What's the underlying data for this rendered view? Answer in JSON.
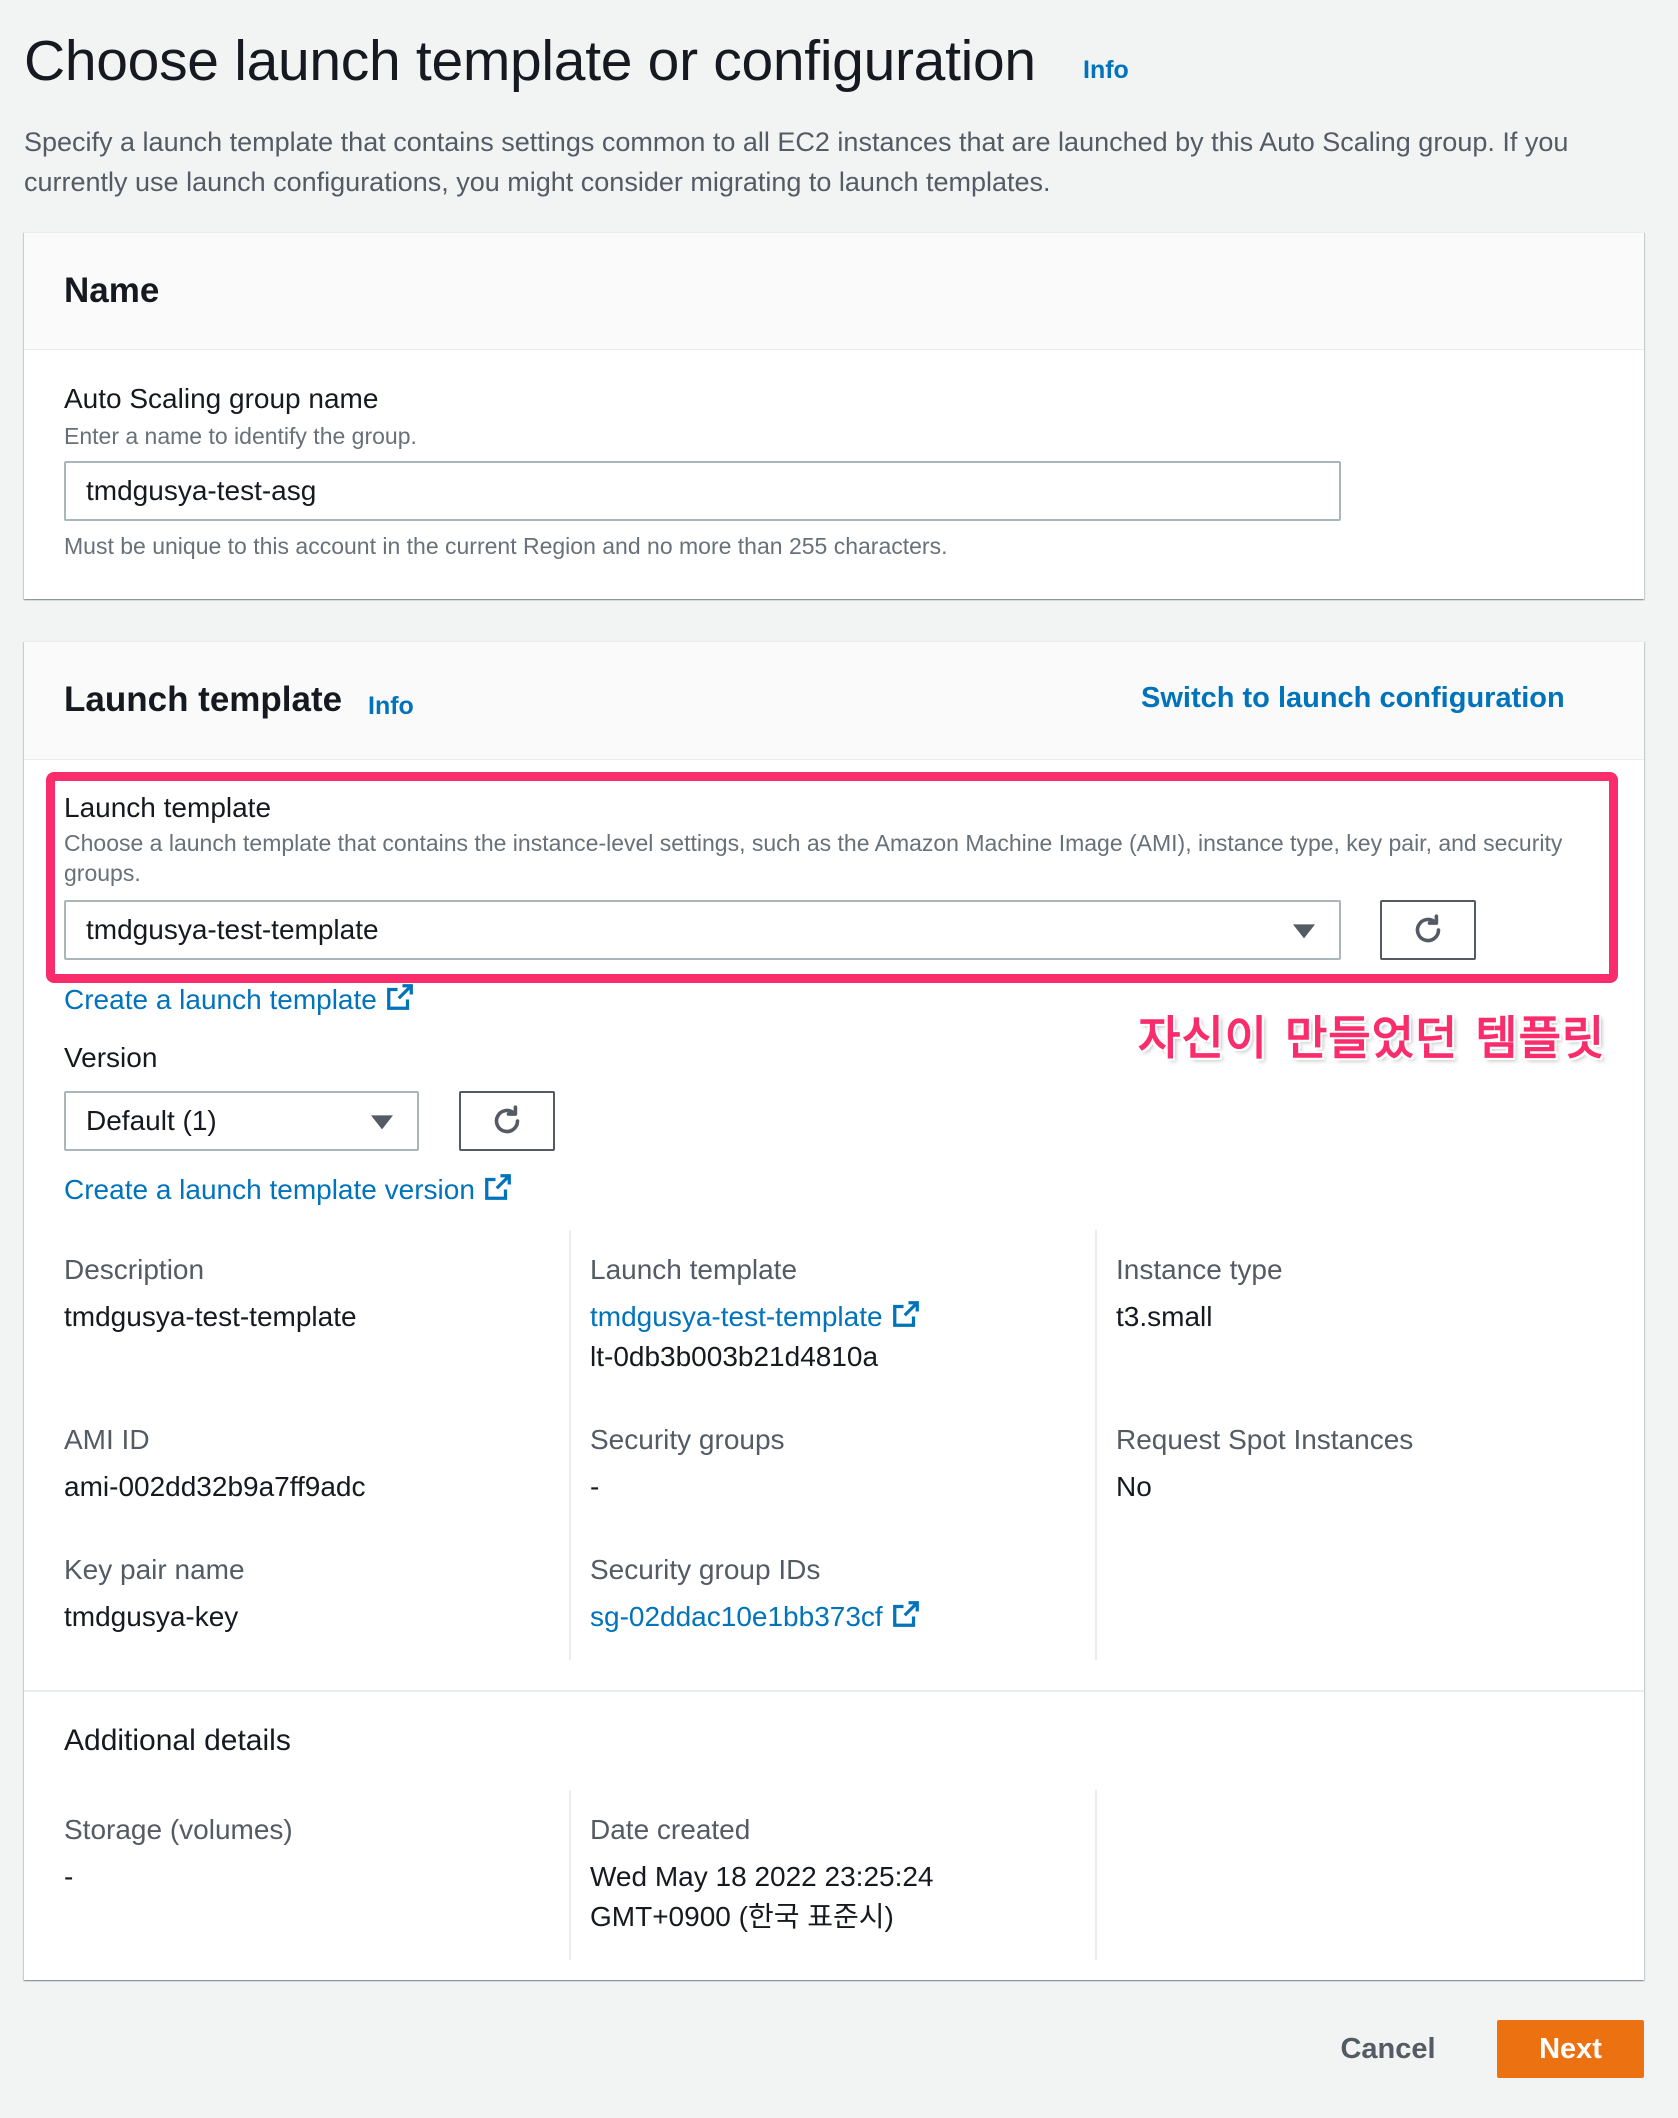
{
  "page": {
    "title": "Choose launch template or configuration",
    "info": "Info",
    "description": "Specify a launch template that contains settings common to all EC2 instances that are launched by this Auto Scaling group. If you currently use launch configurations, you might consider migrating to launch templates."
  },
  "name_panel": {
    "title": "Name",
    "field_label": "Auto Scaling group name",
    "field_hint": "Enter a name to identify the group.",
    "field_value": "tmdgusya-test-asg",
    "field_constraint": "Must be unique to this account in the current Region and no more than 255 characters."
  },
  "template_panel": {
    "title": "Launch template",
    "info": "Info",
    "switch_link": "Switch to launch configuration",
    "template_label": "Launch template",
    "template_hint": "Choose a launch template that contains the instance-level settings, such as the Amazon Machine Image (AMI), instance type, key pair, and security groups.",
    "template_value": "tmdgusya-test-template",
    "create_template_link": "Create a launch template",
    "version_label": "Version",
    "version_value": "Default (1)",
    "create_version_link": "Create a launch template version",
    "details": {
      "description_key": "Description",
      "description_val": "tmdgusya-test-template",
      "launch_template_key": "Launch template",
      "launch_template_link": "tmdgusya-test-template",
      "launch_template_id": "lt-0db3b003b21d4810a",
      "instance_type_key": "Instance type",
      "instance_type_val": "t3.small",
      "ami_key": "AMI ID",
      "ami_val": "ami-002dd32b9a7ff9adc",
      "sg_key": "Security groups",
      "sg_val": "-",
      "spot_key": "Request Spot Instances",
      "spot_val": "No",
      "keypair_key": "Key pair name",
      "keypair_val": "tmdgusya-key",
      "sg_ids_key": "Security group IDs",
      "sg_ids_link": "sg-02ddac10e1bb373cf"
    },
    "additional": {
      "title": "Additional details",
      "storage_key": "Storage (volumes)",
      "storage_val": "-",
      "date_key": "Date created",
      "date_line1": "Wed May 18 2022 23:25:24",
      "date_line2": "GMT+0900 (한국 표준시)"
    }
  },
  "annotation": {
    "text": "자신이 만들었던 템플릿",
    "color": "#fa2d6c"
  },
  "footer": {
    "cancel": "Cancel",
    "next": "Next"
  },
  "colors": {
    "link": "#0073bb",
    "primary_button": "#ec7211",
    "highlight": "#fa2d6c"
  }
}
